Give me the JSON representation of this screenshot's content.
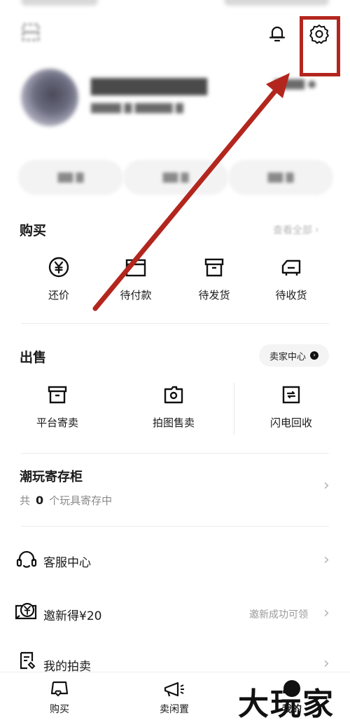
{
  "purchase": {
    "title": "购买",
    "view_all": "查看全部",
    "items": [
      {
        "label": "还价",
        "icon": "yuan-circle-icon"
      },
      {
        "label": "待付款",
        "icon": "wallet-icon"
      },
      {
        "label": "待发货",
        "icon": "box-icon"
      },
      {
        "label": "待收货",
        "icon": "truck-icon"
      }
    ]
  },
  "sell": {
    "title": "出售",
    "seller_center": "卖家中心",
    "items": [
      {
        "label": "平台寄卖",
        "icon": "archive-box-icon"
      },
      {
        "label": "拍图售卖",
        "icon": "camera-folder-icon"
      },
      {
        "label": "闪电回收",
        "icon": "recycle-icon"
      }
    ]
  },
  "locker": {
    "title": "潮玩寄存柜",
    "prefix": "共",
    "count": "0",
    "suffix": "个玩具寄存中"
  },
  "menu": {
    "service": "客服中心",
    "invite": "邀新得¥20",
    "invite_hint": "邀新成功可领",
    "auction": "我的拍卖"
  },
  "tabs": [
    {
      "label": "购买",
      "icon": "buy-tag-icon"
    },
    {
      "label": "卖闲置",
      "icon": "megaphone-icon"
    },
    {
      "label": "我的",
      "icon": "profile-icon"
    }
  ],
  "watermark": "大玩家",
  "colors": {
    "highlight": "#b3261e",
    "arrow": "#b3261e"
  }
}
